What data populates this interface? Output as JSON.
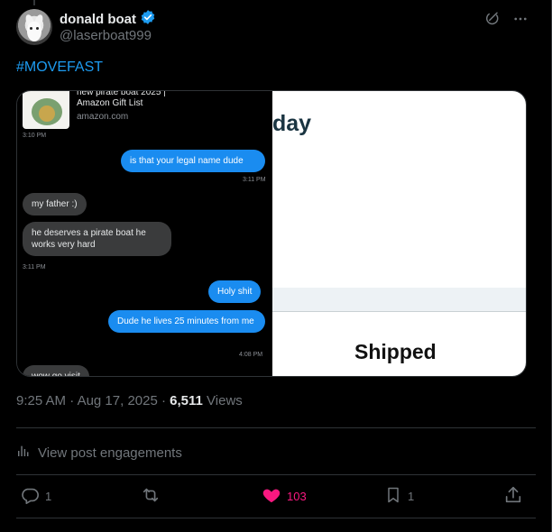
{
  "post": {
    "display_name": "donald boat",
    "handle": "@laserboat999",
    "verified": true,
    "hashtag": "#MOVEFAST",
    "time": "9:25 AM",
    "separator": "·",
    "date": "Aug 17, 2025",
    "views_count": "6,511",
    "views_label": "Views",
    "engagements_label": "View post engagements"
  },
  "media": {
    "chat": {
      "product_title_line1": "new pirate boat 2025 |",
      "product_title_line2": "Amazon Gift List",
      "product_domain": "amazon.com",
      "messages": [
        {
          "time": "3:10 PM"
        },
        {
          "from": "me",
          "text": "is that your legal name dude",
          "time": "3:11 PM"
        },
        {
          "from": "them",
          "text": "my father :)"
        },
        {
          "from": "them",
          "text": "he deserves a pirate boat he works very hard",
          "time": "3:11 PM"
        },
        {
          "from": "me",
          "text": "Holy shit"
        },
        {
          "from": "me",
          "text": "Dude he lives 25 minutes from me",
          "time": "4:08 PM"
        },
        {
          "from": "them",
          "text": "wow go visit"
        }
      ]
    },
    "receipt": {
      "heading_fragment": "day",
      "status": "Shipped"
    }
  },
  "actions": {
    "replies": "1",
    "reposts": "",
    "likes": "103",
    "bookmarks": "1"
  },
  "colors": {
    "background": "#000000",
    "accent_blue": "#1d9bf0",
    "like_pink": "#f91880",
    "muted": "#71767b",
    "divider": "#2f3336"
  },
  "icons": [
    "verified-badge-icon",
    "grok-icon",
    "more-icon",
    "analytics-icon",
    "reply-icon",
    "repost-icon",
    "like-icon",
    "bookmark-icon",
    "share-icon"
  ]
}
